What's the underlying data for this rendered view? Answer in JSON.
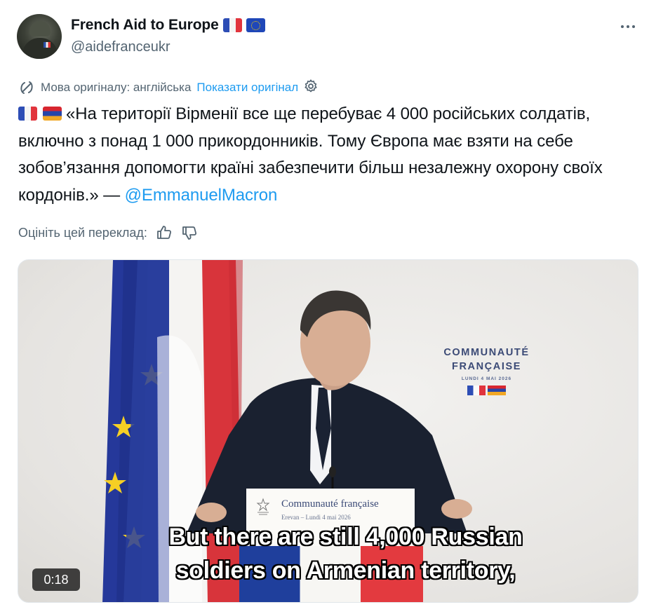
{
  "author": {
    "name": "French Aid to Europe",
    "handle": "@aidefranceukr",
    "name_flags": [
      "france-flag",
      "eu-flag"
    ]
  },
  "more_menu": {
    "icon": "more-horizontal-icon"
  },
  "translation": {
    "original_language": "Мова оригіналу: англійська",
    "show_original": "Показати оригінал",
    "settings_icon": "gear-icon"
  },
  "tweet": {
    "flags": [
      "france-flag",
      "armenia-flag"
    ],
    "text": "«На території Вірменії все ще перебуває 4 000 російських солдатів, включно з понад 1 000 прикордонників. Тому Європа має взяти на себе зобов’язання допомогти країні забезпечити більш незалежну охорону своїх кордонів.» —",
    "mention": "@EmmanuelMacron"
  },
  "rating": {
    "label": "Оцініть цей переклад:",
    "like_icon": "thumbs-up-icon",
    "dislike_icon": "thumbs-down-icon"
  },
  "video": {
    "backdrop": {
      "line1": "COMMUNAUTÉ",
      "line2": "FRANÇAISE",
      "line3": "LUNDI 4 MAI 2026"
    },
    "podium": {
      "title": "Communauté française",
      "subtitle": "Erevan – Lundi 4 mai 2026"
    },
    "captions": {
      "line1": "But there are still 4,000 Russian",
      "line2": "soldiers on Armenian territory,"
    },
    "timestamp": "0:18"
  },
  "colors": {
    "link": "#1d9bf0",
    "secondary_text": "#536471",
    "primary_text": "#0f1419"
  }
}
